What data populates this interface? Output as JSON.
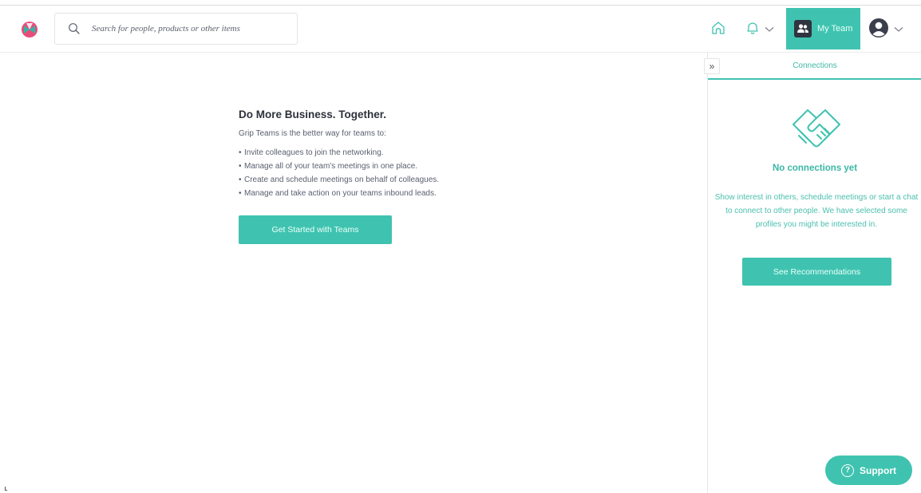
{
  "header": {
    "search_placeholder": "Search for people, products or other items",
    "my_team_label": "My Team"
  },
  "main": {
    "heading": "Do More Business. Together.",
    "intro": "Grip Teams is the better way for teams to:",
    "bullets": [
      "Invite colleagues to join the networking.",
      "Manage all of your team's meetings in one place.",
      "Create and schedule meetings on behalf of colleagues.",
      "Manage and take action on your teams inbound leads."
    ],
    "cta_label": "Get Started with Teams"
  },
  "side_panel": {
    "collapse_glyph": "»",
    "tab_label": "Connections",
    "empty_title": "No connections yet",
    "empty_description": "Show interest in others, schedule meetings or start a chat to connect to other people. We have selected some profiles you might be interested in.",
    "recommendations_label": "See Recommendations"
  },
  "support": {
    "label": "Support",
    "glyph": "?"
  },
  "colors": {
    "accent": "#3fc3b0",
    "accent_text": "#3ab8a5",
    "logo_pink": "#e84d7a",
    "logo_teal": "#2fb7a6"
  },
  "icons": [
    "logo-icon",
    "search-icon",
    "home-icon",
    "bell-icon",
    "chevron-down-icon",
    "team-icon",
    "avatar-icon",
    "handshake-icon",
    "help-circle-icon"
  ]
}
